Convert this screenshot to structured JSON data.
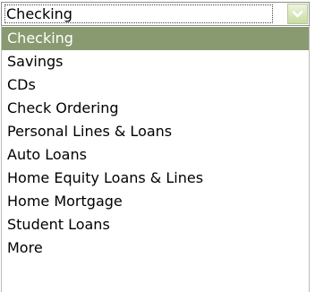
{
  "select": {
    "value": "Checking",
    "options": [
      {
        "label": "Checking",
        "selected": true
      },
      {
        "label": "Savings",
        "selected": false
      },
      {
        "label": "CDs",
        "selected": false
      },
      {
        "label": "Check Ordering",
        "selected": false
      },
      {
        "label": "Personal Lines & Loans",
        "selected": false
      },
      {
        "label": "Auto Loans",
        "selected": false
      },
      {
        "label": "Home Equity Loans & Lines",
        "selected": false
      },
      {
        "label": "Home Mortgage",
        "selected": false
      },
      {
        "label": "Student Loans",
        "selected": false
      },
      {
        "label": "More",
        "selected": false
      }
    ]
  },
  "icons": {
    "arrow": "chevron-down-icon"
  },
  "colors": {
    "highlight": "#8a9a70",
    "arrow_button": "#c7dca0"
  }
}
